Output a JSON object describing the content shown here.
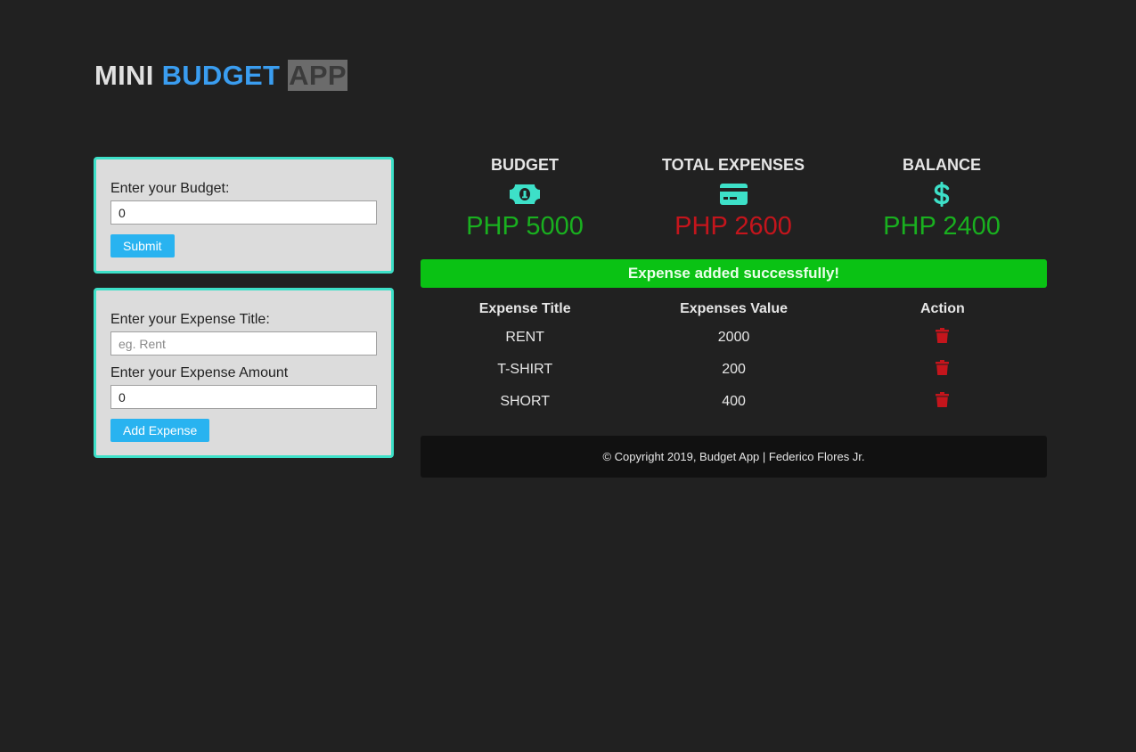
{
  "header": {
    "title_part1": "MINI",
    "title_part2": "BUDGET",
    "title_part3": "APP"
  },
  "budget_form": {
    "label": "Enter your Budget:",
    "value": "0",
    "submit_label": "Submit"
  },
  "expense_form": {
    "title_label": "Enter your Expense Title:",
    "title_placeholder": "eg. Rent",
    "amount_label": "Enter your Expense Amount",
    "amount_value": "0",
    "add_label": "Add Expense"
  },
  "summary": {
    "budget": {
      "label": "BUDGET",
      "value": "PHP 5000",
      "icon": "money-bill-icon"
    },
    "expenses": {
      "label": "TOTAL EXPENSES",
      "value": "PHP 2600",
      "icon": "credit-card-icon"
    },
    "balance": {
      "label": "BALANCE",
      "value": "PHP 2400",
      "icon": "dollar-sign-icon"
    }
  },
  "alert": {
    "message": "Expense added successfully!"
  },
  "table": {
    "headers": [
      "Expense Title",
      "Expenses Value",
      "Action"
    ],
    "rows": [
      {
        "title": "RENT",
        "value": "2000"
      },
      {
        "title": "T-SHIRT",
        "value": "200"
      },
      {
        "title": "SHORT",
        "value": "400"
      }
    ]
  },
  "footer": {
    "text": "© Copyright 2019, Budget App | Federico Flores Jr."
  },
  "colors": {
    "accent_teal": "#3de0c8",
    "title_blue": "#3a9df0",
    "positive_green": "#19b01f",
    "negative_red": "#c4151c",
    "alert_green": "#0ac214",
    "button_blue": "#29b3f0"
  }
}
